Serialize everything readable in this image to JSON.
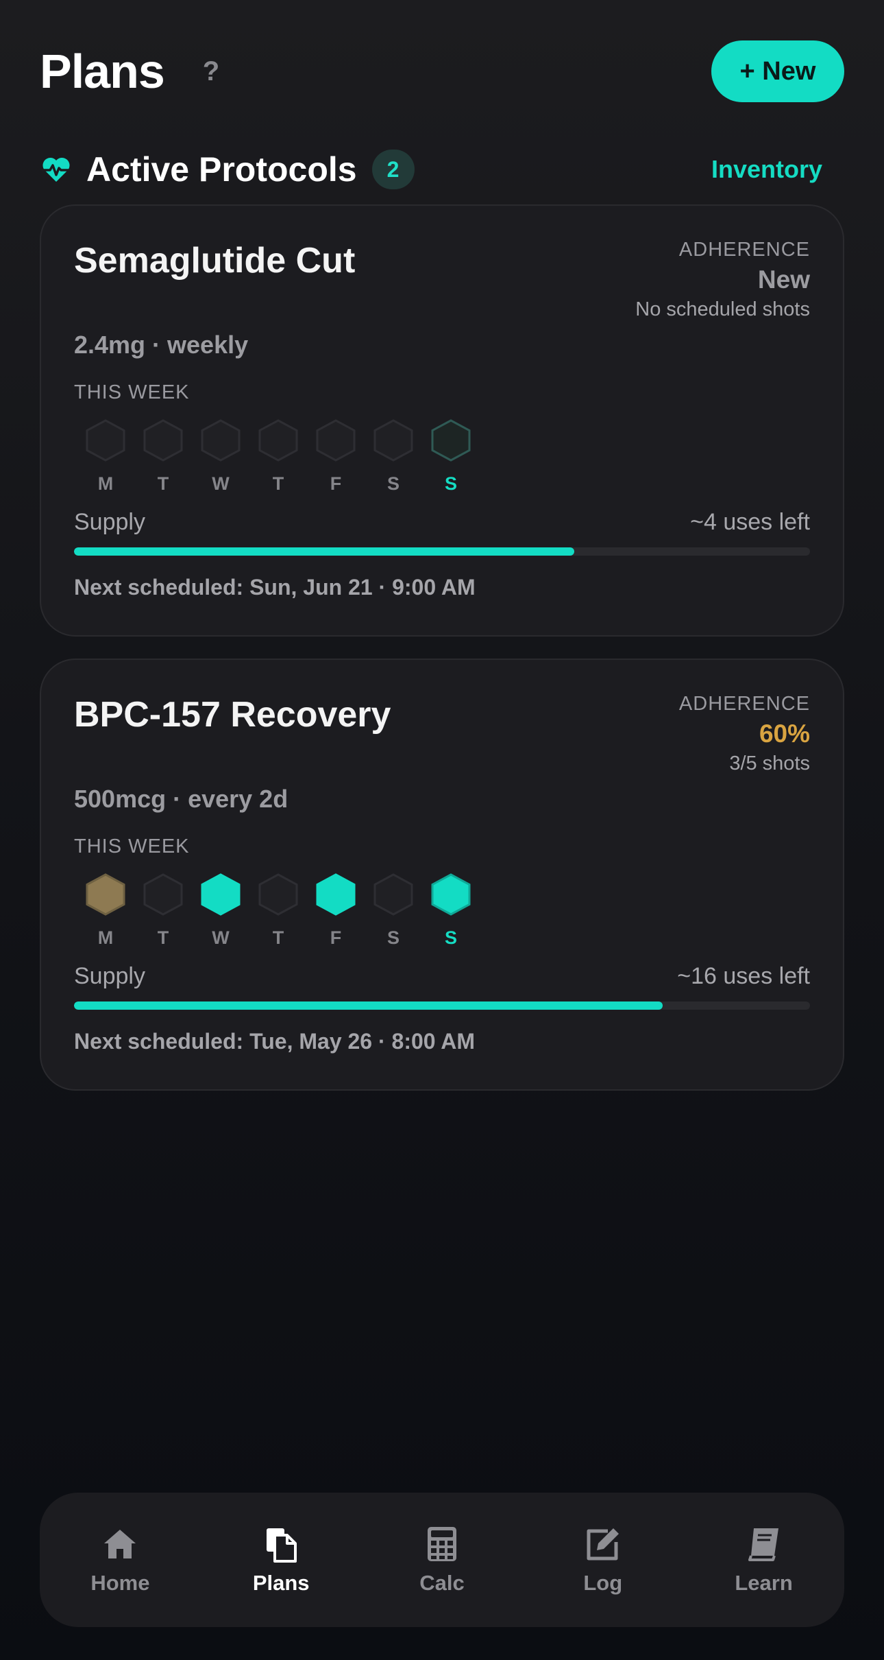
{
  "header": {
    "title": "Plans",
    "help_label": "?",
    "new_button": "+ New"
  },
  "section": {
    "title": "Active Protocols",
    "count": "2",
    "inventory_link": "Inventory"
  },
  "colors": {
    "accent": "#13dcc4",
    "warning": "#d9a441",
    "missed": "#8e7a52"
  },
  "protocols": [
    {
      "name": "Semaglutide Cut",
      "adherence_label": "ADHERENCE",
      "adherence_value": "New",
      "adherence_sub": "No scheduled shots",
      "dose": "2.4mg · weekly",
      "week_label": "THIS WEEK",
      "days": [
        {
          "letter": "M",
          "state": "empty"
        },
        {
          "letter": "T",
          "state": "empty"
        },
        {
          "letter": "W",
          "state": "empty"
        },
        {
          "letter": "T",
          "state": "empty"
        },
        {
          "letter": "F",
          "state": "empty"
        },
        {
          "letter": "S",
          "state": "empty"
        },
        {
          "letter": "S",
          "state": "today-scheduled"
        }
      ],
      "supply_label": "Supply",
      "supply_left": "~4 uses left",
      "supply_fraction": 0.68,
      "next": "Next scheduled: Sun, Jun 21 · 9:00 AM"
    },
    {
      "name": "BPC-157 Recovery",
      "adherence_label": "ADHERENCE",
      "adherence_value": "60%",
      "adherence_sub": "3/5 shots",
      "dose": "500mcg · every 2d",
      "week_label": "THIS WEEK",
      "days": [
        {
          "letter": "M",
          "state": "missed"
        },
        {
          "letter": "T",
          "state": "empty"
        },
        {
          "letter": "W",
          "state": "done"
        },
        {
          "letter": "T",
          "state": "empty"
        },
        {
          "letter": "F",
          "state": "done"
        },
        {
          "letter": "S",
          "state": "empty"
        },
        {
          "letter": "S",
          "state": "today-done"
        }
      ],
      "supply_label": "Supply",
      "supply_left": "~16 uses left",
      "supply_fraction": 0.8,
      "next": "Next scheduled: Tue, May 26 · 8:00 AM"
    }
  ],
  "nav": [
    {
      "label": "Home",
      "icon": "home-icon",
      "active": false
    },
    {
      "label": "Plans",
      "icon": "plans-icon",
      "active": true
    },
    {
      "label": "Calc",
      "icon": "calculator-icon",
      "active": false
    },
    {
      "label": "Log",
      "icon": "edit-icon",
      "active": false
    },
    {
      "label": "Learn",
      "icon": "book-icon",
      "active": false
    }
  ]
}
